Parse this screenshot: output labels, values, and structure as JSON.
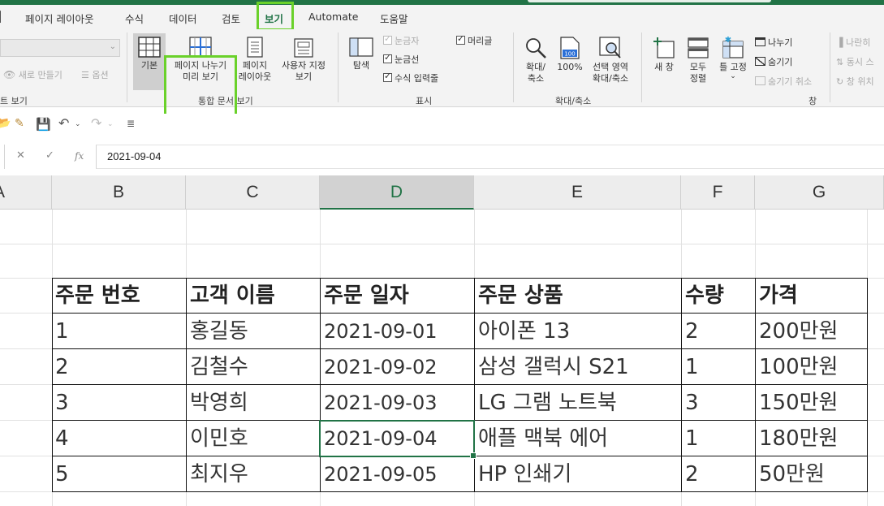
{
  "tabs": [
    "페이지 레이아웃",
    "수식",
    "데이터",
    "검토",
    "보기",
    "Automate",
    "도움말"
  ],
  "active_tab": "보기",
  "ribbon": {
    "sheet_view": {
      "dropdown_value": "",
      "new_view": "새로 만들기",
      "options": "옵션",
      "group_label": "트 보기"
    },
    "workbook_views": {
      "normal": "기본",
      "page_break_line1": "페이지 나누기",
      "page_break_line2": "미리 보기",
      "page_layout_line1": "페이지",
      "page_layout_line2": "레이아웃",
      "custom_line1": "사용자 지정",
      "custom_line2": "보기",
      "group_label": "통합 문서 보기"
    },
    "show": {
      "navigator": "탐색",
      "ruler": "눈금자",
      "gridlines": "눈금선",
      "formula_bar": "수식 입력줄",
      "headings": "머리글",
      "group_label": "표시"
    },
    "zoom": {
      "zoom_line1": "확대/",
      "zoom_line2": "축소",
      "hundred": "100%",
      "hundred_icon_text": "100",
      "selection_line1": "선택 영역",
      "selection_line2": "확대/축소",
      "group_label": "확대/축소"
    },
    "window": {
      "new_window": "새 창",
      "arrange_line1": "모두",
      "arrange_line2": "정렬",
      "freeze": "틀 고정",
      "split": "나누기",
      "hide": "숨기기",
      "unhide": "숨기기 취소",
      "side_by_side": "나란히",
      "sync_scroll": "동시 스",
      "reset_position": "창 위치",
      "group_label": "창"
    }
  },
  "formula_bar": {
    "fx": "fx",
    "value": "2021-09-04"
  },
  "columns": [
    "A",
    "B",
    "C",
    "D",
    "E",
    "F",
    "G"
  ],
  "selected_column": "D",
  "table": {
    "headers": [
      "주문 번호",
      "고객 이름",
      "주문 일자",
      "주문 상품",
      "수량",
      "가격"
    ],
    "rows": [
      [
        "1",
        "홍길동",
        "2021-09-01",
        "아이폰 13",
        "2",
        "200만원"
      ],
      [
        "2",
        "김철수",
        "2021-09-02",
        "삼성 갤럭시 S21",
        "1",
        "100만원"
      ],
      [
        "3",
        "박영희",
        "2021-09-03",
        "LG 그램 노트북",
        "3",
        "150만원"
      ],
      [
        "4",
        "이민호",
        "2021-09-04",
        "애플 맥북 에어",
        "1",
        "180만원"
      ],
      [
        "5",
        "최지우",
        "2021-09-05",
        "HP 인쇄기",
        "2",
        "50만원"
      ]
    ]
  },
  "colors": {
    "accent": "#217346",
    "highlight": "#6ad12a"
  }
}
